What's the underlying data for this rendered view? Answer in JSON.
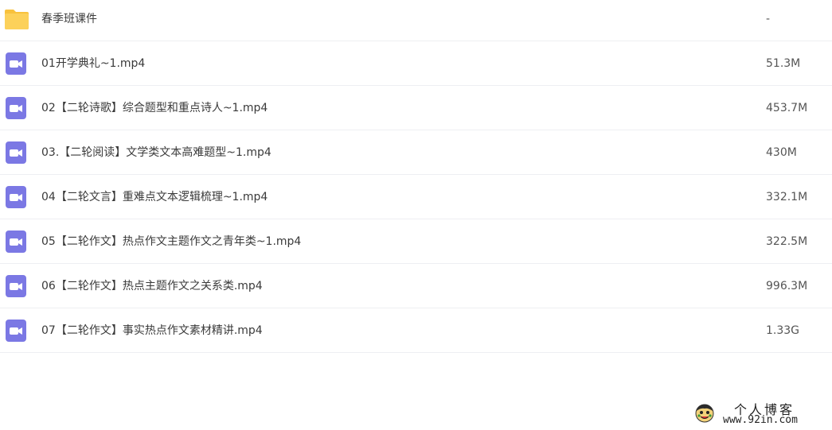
{
  "files": [
    {
      "type": "folder",
      "icon": "folder-icon",
      "name": "春季班课件",
      "size": "-"
    },
    {
      "type": "video",
      "icon": "video-file-icon",
      "name": "01开学典礼~1.mp4",
      "size": "51.3M"
    },
    {
      "type": "video",
      "icon": "video-file-icon",
      "name": "02【二轮诗歌】综合题型和重点诗人~1.mp4",
      "size": "453.7M"
    },
    {
      "type": "video",
      "icon": "video-file-icon",
      "name": "03.【二轮阅读】文学类文本高难题型~1.mp4",
      "size": "430M"
    },
    {
      "type": "video",
      "icon": "video-file-icon",
      "name": "04【二轮文言】重难点文本逻辑梳理~1.mp4",
      "size": "332.1M"
    },
    {
      "type": "video",
      "icon": "video-file-icon",
      "name": "05【二轮作文】热点作文主题作文之青年类~1.mp4",
      "size": "322.5M"
    },
    {
      "type": "video",
      "icon": "video-file-icon",
      "name": "06【二轮作文】热点主题作文之关系类.mp4",
      "size": "996.3M"
    },
    {
      "type": "video",
      "icon": "video-file-icon",
      "name": "07【二轮作文】事实热点作文素材精讲.mp4",
      "size": "1.33G"
    }
  ],
  "watermark": {
    "title": "个人博客",
    "url": "www.92in.com",
    "logo_icon": "cartoon-face-icon"
  },
  "colors": {
    "folder": "#fcd15a",
    "folder_tab": "#f8c23d",
    "video": "#7b78e4",
    "divider": "#eeeff2"
  }
}
